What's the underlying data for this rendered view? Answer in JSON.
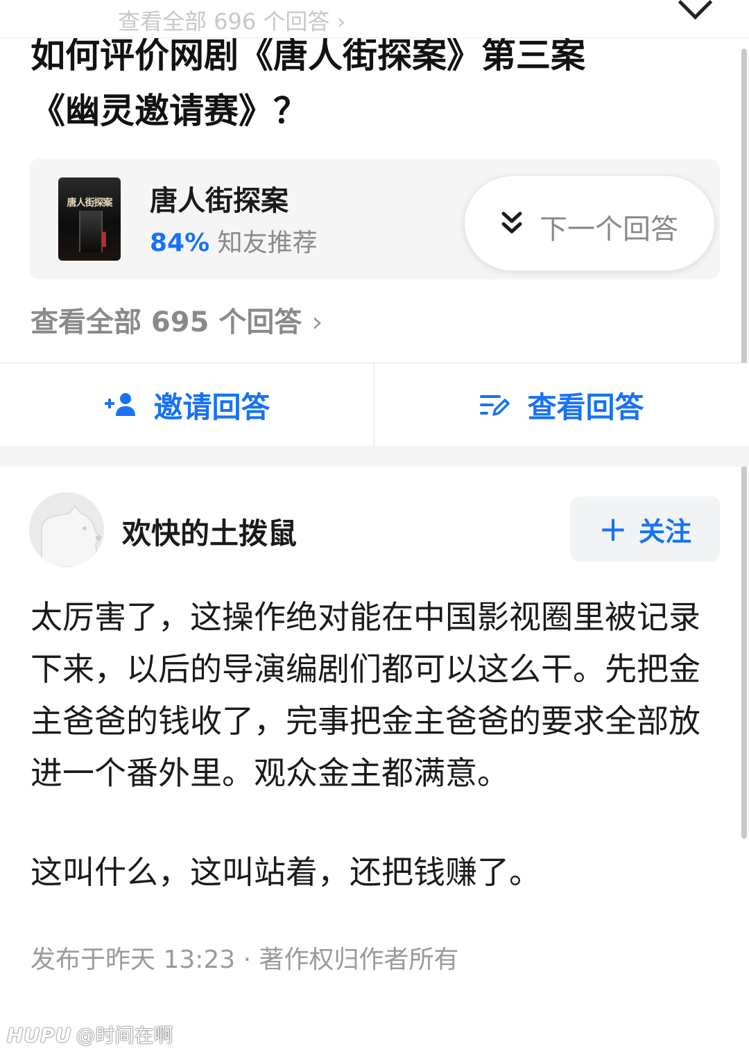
{
  "top_bar": {
    "faded_count": "查看全部 696 个回答 ›"
  },
  "question": {
    "title_line1": "如何评价网剧《唐人街探案》第三案",
    "title_line2": "《幽灵邀请赛》？"
  },
  "show_card": {
    "name": "唐人街探案",
    "rating_percent": "84%",
    "rating_label": "知友推荐",
    "poster_text": "唐人街探案"
  },
  "next_answer": {
    "label": "下一个回答"
  },
  "view_all": {
    "label": "查看全部 695 个回答",
    "chevron": "›"
  },
  "actions": {
    "invite_label": "邀请回答",
    "view_label": "查看回答"
  },
  "answer": {
    "author": "欢快的土拨鼠",
    "follow_label": "关注",
    "follow_icon": "+",
    "paragraphs": [
      "太厉害了，这操作绝对能在中国影视圈里被记录下来，以后的导演编剧们都可以这么干。先把金主爸爸的钱收了，完事把金主爸爸的要求全部放进一个番外里。观众金主都满意。",
      "这叫什么，这叫站着，还把钱赚了。"
    ],
    "meta": "发布于昨天 13:23 · 著作权归作者所有"
  },
  "watermark": {
    "brand": "HUPU",
    "handle": "@时间在啊"
  },
  "colors": {
    "accent": "#1772f6",
    "muted_text": "#8a8a8a",
    "card_bg": "#f5f5f6"
  }
}
